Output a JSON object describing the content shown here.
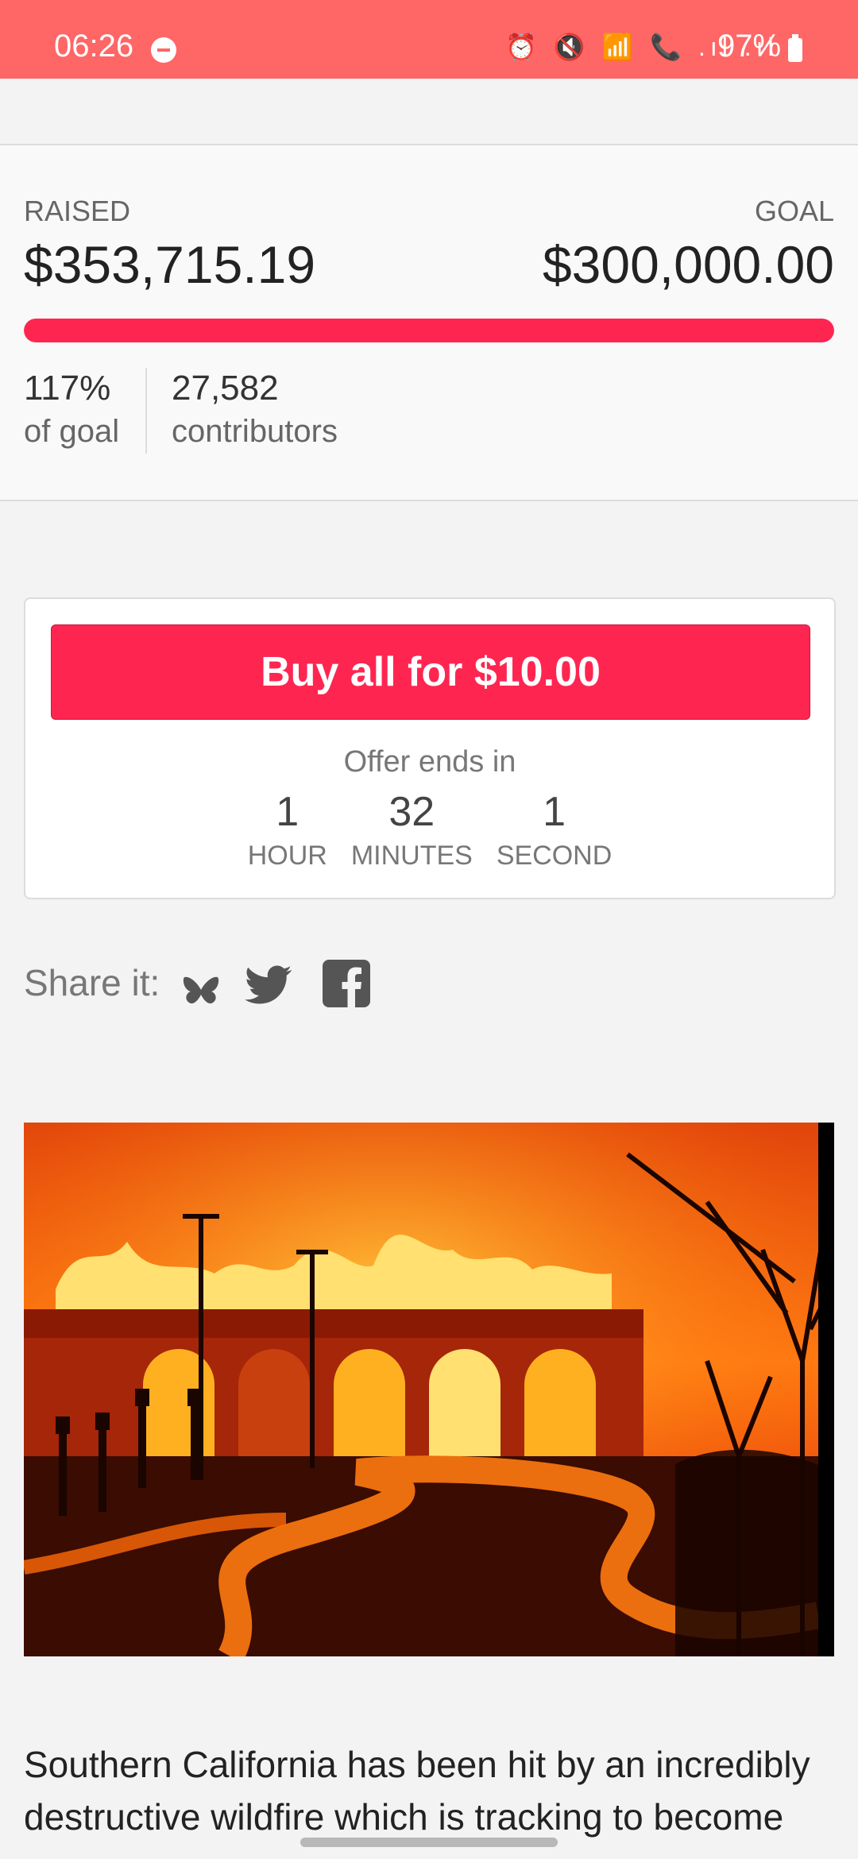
{
  "status_bar": {
    "time": "06:26",
    "icons": "⏰ 🔇 📶 📞 .ıl .ıl",
    "battery_pct": "97%"
  },
  "stats": {
    "raised_label": "RAISED",
    "raised_value": "$353,715.19",
    "goal_label": "GOAL",
    "goal_value": "$300,000.00",
    "progress_fraction": 1.0,
    "percent_of_goal": "117%",
    "percent_label": "of goal",
    "contributors": "27,582",
    "contributors_label": "contributors",
    "accent_color": "#fe2651"
  },
  "offer": {
    "buy_button": "Buy all for $10.00",
    "ends_label": "Offer ends in",
    "timer": [
      {
        "value": "1",
        "unit": "HOUR"
      },
      {
        "value": "32",
        "unit": "MINUTES"
      },
      {
        "value": "1",
        "unit": "SECOND"
      }
    ]
  },
  "share": {
    "label": "Share it:",
    "icons": [
      "bluesky-icon",
      "twitter-icon",
      "facebook-icon"
    ]
  },
  "description": "Southern California has been hit by an incredibly destructive wildfire which is tracking to become"
}
